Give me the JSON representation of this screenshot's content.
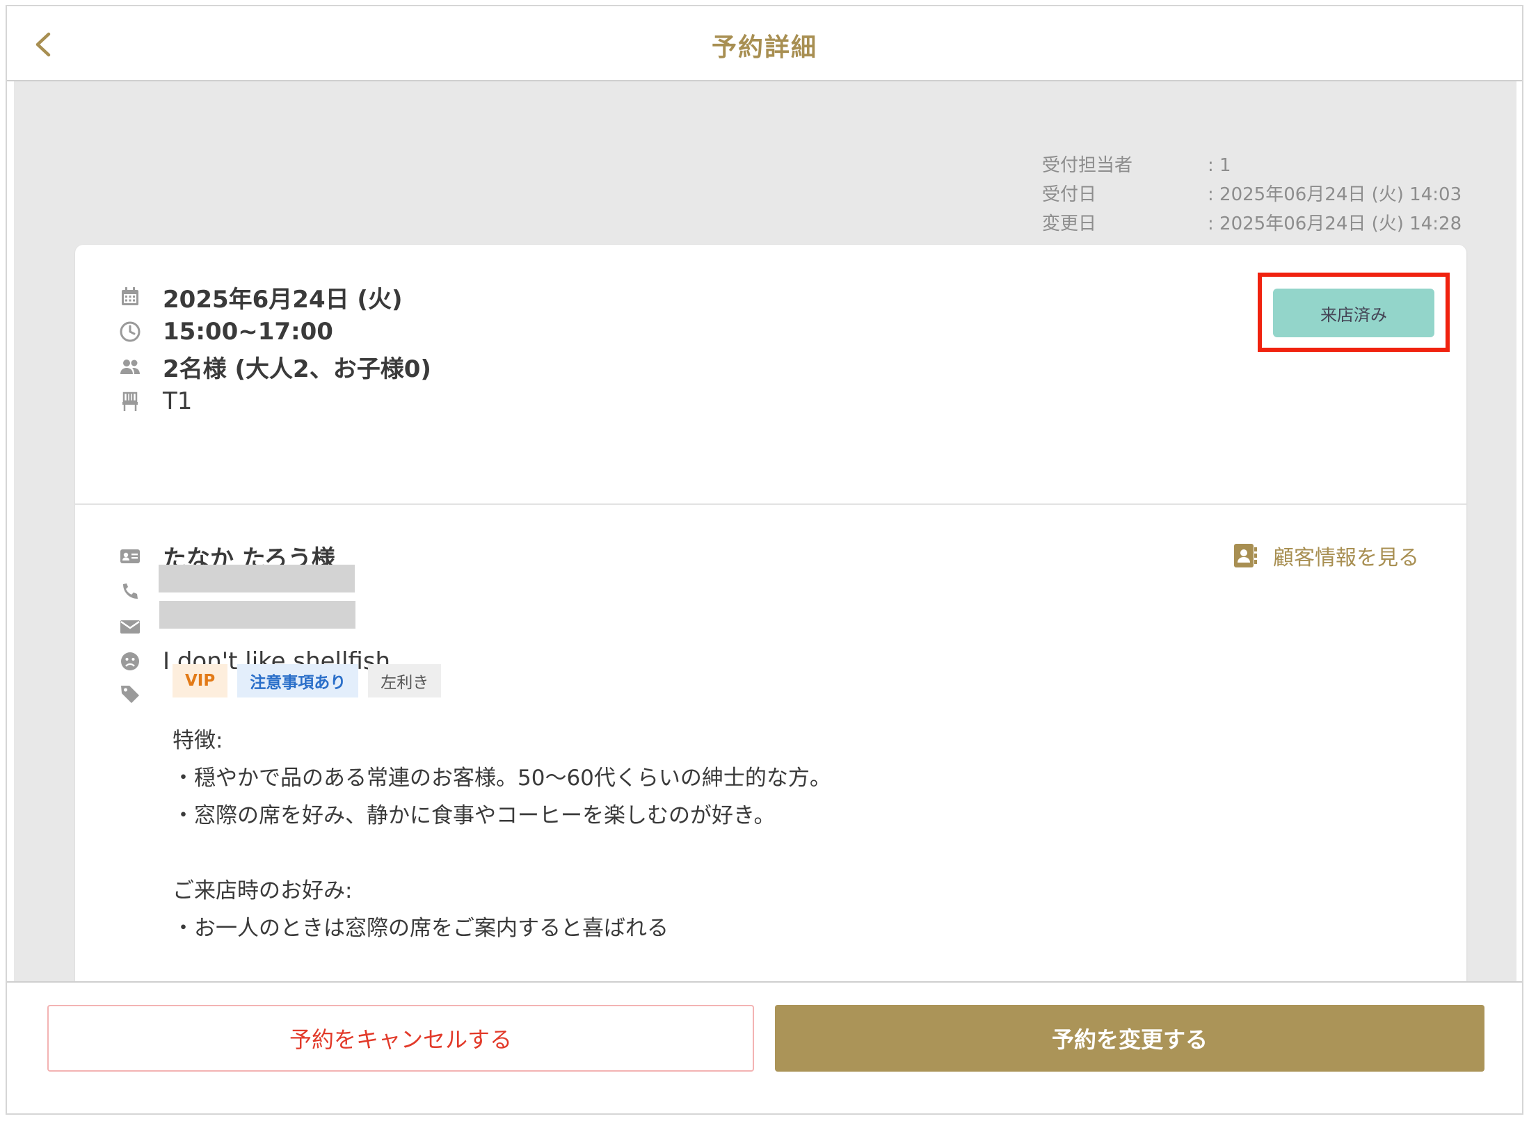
{
  "header": {
    "title": "予約詳細",
    "back_icon": "chevron-left-icon"
  },
  "meta": [
    {
      "key": "受付担当者",
      "value": ": 1"
    },
    {
      "key": "受付日",
      "value": ": 2025年06月24日 (火) 14:03"
    },
    {
      "key": "変更日",
      "value": ": 2025年06月24日 (火) 14:28"
    }
  ],
  "reservation": {
    "date": "2025年6月24日 (火)",
    "time": "15:00~17:00",
    "party": "2名様 (大人2、お子様0)",
    "table": "T1",
    "status": "来店済み"
  },
  "customer": {
    "name": "たなか たろう様",
    "link_label": "顧客情報を見る",
    "allergy": "I don't like shellfish.",
    "tags": [
      "VIP",
      "注意事項あり",
      "左利き"
    ],
    "notes": "特徴:\n・穏やかで品のある常連のお客様。50～60代くらいの紳士的な方。\n・窓際の席を好み、静かに食事やコーヒーを楽しむのが好き。\n\nご来店時のお好み:\n・お一人のときは窓際の席をご案内すると喜ばれる"
  },
  "footer": {
    "cancel_label": "予約をキャンセルする",
    "change_label": "予約を変更する"
  },
  "colors": {
    "accent": "#a88f52",
    "status": "#93d5ca",
    "danger": "#e23a2a",
    "highlight": "#f0220f"
  }
}
